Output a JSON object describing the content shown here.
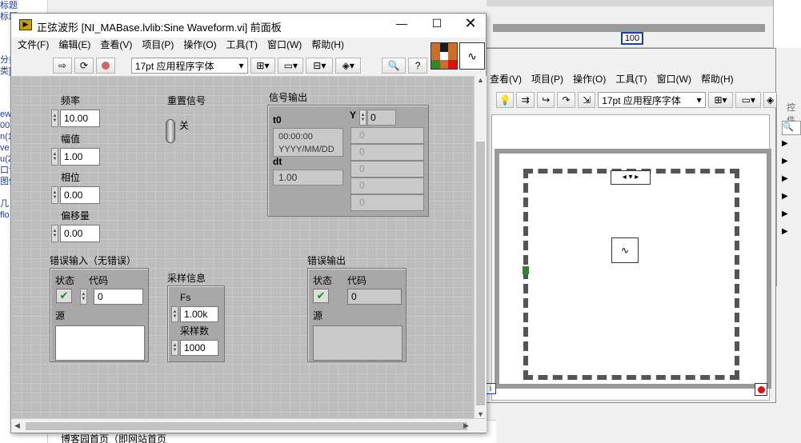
{
  "back_left": {
    "lines": [
      "标题",
      "标题",
      "分类",
      "ew",
      "00(",
      "n(1",
      "ve",
      "u(2",
      "口识",
      "图像",
      "几 u",
      "flo",
      "类]"
    ]
  },
  "back_bottom_text": "博客园首页（即网站首页",
  "block_window": {
    "menu": [
      "查看(V)",
      "项目(P)",
      "操作(O)",
      "工具(T)",
      "窗口(W)",
      "帮助(H)"
    ],
    "font": "17pt 应用程序字体",
    "const_100": "100",
    "info_i": "i",
    "palette_search": "控件"
  },
  "front_window": {
    "title": "正弦波形 [NI_MABase.lvlib:Sine Waveform.vi] 前面板",
    "menu": [
      "文件(F)",
      "编辑(E)",
      "查看(V)",
      "项目(P)",
      "操作(O)",
      "工具(T)",
      "窗口(W)",
      "帮助(H)"
    ],
    "font": "17pt 应用程序字体",
    "controls": {
      "freq_label": "频率",
      "freq_value": "10.00",
      "amp_label": "幅值",
      "amp_value": "1.00",
      "phase_label": "相位",
      "phase_value": "0.00",
      "offset_label": "偏移量",
      "offset_value": "0.00",
      "reset_label": "重置信号",
      "reset_state": "关",
      "signal_out_label": "信号输出",
      "t0_label": "t0",
      "t0_time": "00:00:00",
      "t0_date": "YYYY/MM/DD",
      "dt_label": "dt",
      "dt_value": "1.00",
      "y_label": "Y",
      "y_index": "0",
      "y_values": [
        "0",
        "0",
        "0",
        "0",
        "0"
      ],
      "err_in_label": "错误输入（无错误）",
      "status_label": "状态",
      "code_label": "代码",
      "code_value": "0",
      "source_label": "源",
      "sample_label": "采样信息",
      "fs_label": "Fs",
      "fs_value": "1.00k",
      "n_label": "采样数",
      "n_value": "1000",
      "err_out_label": "错误输出",
      "status_out_label": "状态",
      "code_out_label": "代码",
      "code_out_value": "0",
      "source_out_label": "源"
    }
  }
}
